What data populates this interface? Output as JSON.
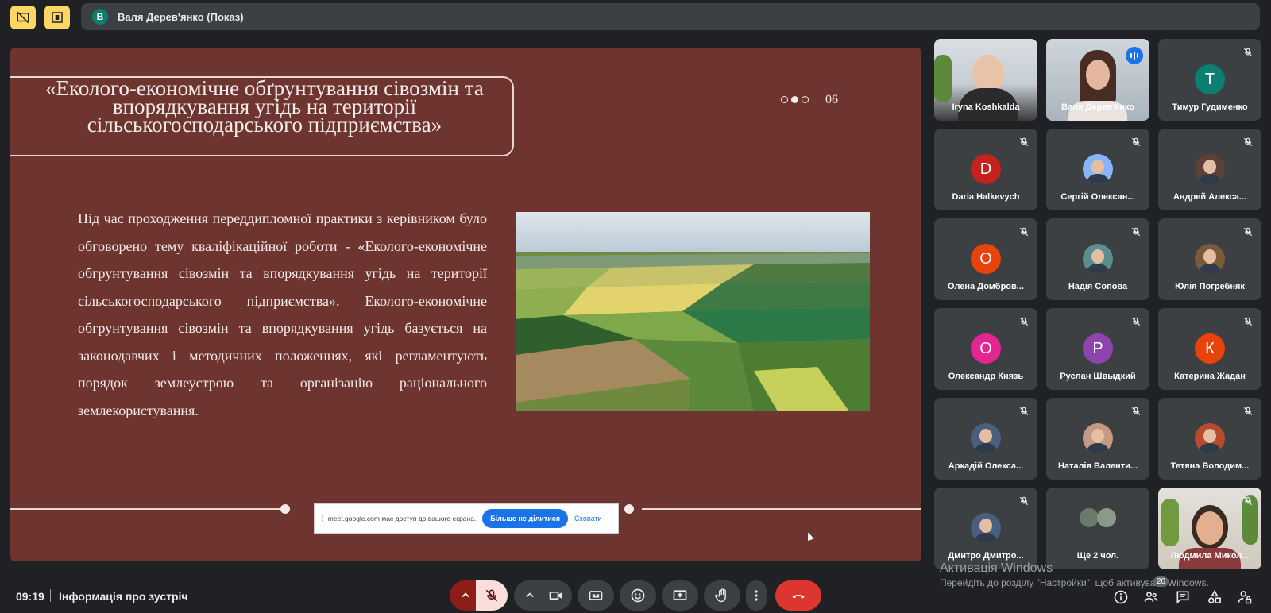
{
  "header": {
    "presenter_initial": "В",
    "presenter_name": "Валя Дерев'янко (Показ)"
  },
  "slide": {
    "title": "«Еколого-економічне обґрунтування сівозмін та впорядкування угідь на території сільськогосподарського підприємства»",
    "slide_number": "06",
    "body": "Під час проходження переддипломної практики з керівником було обговорено тему кваліфікаційної роботи - «Еколого-економічне обгрунтування сівозмін та впорядкування угідь на території сільськогосподарського підприємства». Еколого-економічне обгрунтування сівозмін та впорядкування угідь  базується на законодавчих і методичних положеннях, які регламентують порядок землеустрою та організацію раціонального землекористування."
  },
  "share_banner": {
    "message": "meet.google.com має доступ до вашого екрана.",
    "stop_label": "Більше не ділитися",
    "hide_label": "Сховати"
  },
  "participants": [
    {
      "name": "Iryna Koshkalda",
      "initial": "",
      "color": "",
      "type": "video"
    },
    {
      "name": "Валя Дерев'янко",
      "initial": "",
      "color": "",
      "type": "video"
    },
    {
      "name": "Тимур Гудименко",
      "initial": "Т",
      "color": "#0b8070",
      "type": "letter"
    },
    {
      "name": "Daria Halkevych",
      "initial": "D",
      "color": "#c5221f",
      "type": "letter"
    },
    {
      "name": "Сергій Олексан...",
      "initial": "",
      "color": "#8ab4f8",
      "type": "photo"
    },
    {
      "name": "Андрей Алекса...",
      "initial": "",
      "color": "#5d4037",
      "type": "photo"
    },
    {
      "name": "Олена Домбров...",
      "initial": "О",
      "color": "#e8430a",
      "type": "letter"
    },
    {
      "name": "Надія Сопова",
      "initial": "",
      "color": "#5b8f8f",
      "type": "photo"
    },
    {
      "name": "Юлія Погребняк",
      "initial": "",
      "color": "#7a5a3a",
      "type": "photo"
    },
    {
      "name": "Олександр Князь",
      "initial": "О",
      "color": "#e52592",
      "type": "letter"
    },
    {
      "name": "Руслан Швыдкий",
      "initial": "Р",
      "color": "#8e44ad",
      "type": "letter"
    },
    {
      "name": "Катерина Жадан",
      "initial": "К",
      "color": "#e8430a",
      "type": "letter"
    },
    {
      "name": "Аркадій Олекса...",
      "initial": "",
      "color": "#4a5f80",
      "type": "photo"
    },
    {
      "name": "Наталія Валенти...",
      "initial": "",
      "color": "#c49a85",
      "type": "photo"
    },
    {
      "name": "Тетяна Володим...",
      "initial": "",
      "color": "#b84a30",
      "type": "photo"
    },
    {
      "name": "Дмитро Дмитро...",
      "initial": "",
      "color": "#4a5f80",
      "type": "photo"
    },
    {
      "name": "Ще 2 чол.",
      "initial": "",
      "color": "#6b7a6b",
      "type": "more"
    },
    {
      "name": "Людмила Микол...",
      "initial": "",
      "color": "",
      "type": "video"
    }
  ],
  "watermark": {
    "title": "Активація Windows",
    "subtitle": "Перейдіть до розділу \"Настройки\", щоб активувати Windows."
  },
  "bottom": {
    "time": "09:19",
    "meeting_info": "Інформація про зустріч",
    "participant_count": "20"
  }
}
